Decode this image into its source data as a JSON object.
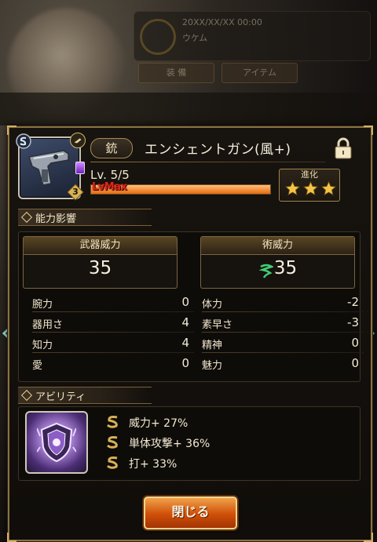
{
  "background": {
    "panel_line1": "20XX/XX/XX 00:00",
    "panel_line2": "ウケム",
    "tab_left": "装 備",
    "tab_right": "アイテム"
  },
  "item": {
    "type_label": "銃",
    "name": "エンシェントガン(風+)",
    "level_text": "Lv. 5/5",
    "level_max_label": "LvMax",
    "level_progress": 1.0,
    "rank_number": "3",
    "icon": "ancient-gun-icon",
    "locked": true
  },
  "evolution": {
    "label": "進化",
    "stars": 3
  },
  "stats_section": {
    "title": "能力影響",
    "weapon_power": {
      "label": "武器威力",
      "value": "35"
    },
    "magic_power": {
      "label": "術威力",
      "value": "35",
      "element_icon": "wind-element-icon"
    },
    "left": [
      {
        "label": "腕力",
        "value": "0"
      },
      {
        "label": "器用さ",
        "value": "4"
      },
      {
        "label": "知力",
        "value": "4"
      },
      {
        "label": "愛",
        "value": "0"
      }
    ],
    "right": [
      {
        "label": "体力",
        "value": "-2"
      },
      {
        "label": "素早さ",
        "value": "-3"
      },
      {
        "label": "精神",
        "value": "0"
      },
      {
        "label": "魅力",
        "value": "0"
      }
    ]
  },
  "ability_section": {
    "title": "アビリティ",
    "icon": "crest-ability-icon",
    "lines": [
      "威力+ 27%",
      "単体攻撃+ 36%",
      "打+ 33%"
    ]
  },
  "close_button": {
    "label": "閉じる"
  },
  "colors": {
    "gold_border": "#8c7241",
    "accent_orange": "#e86a10",
    "lvmax_red": "#e02418",
    "star_gold": "#f2c447"
  }
}
